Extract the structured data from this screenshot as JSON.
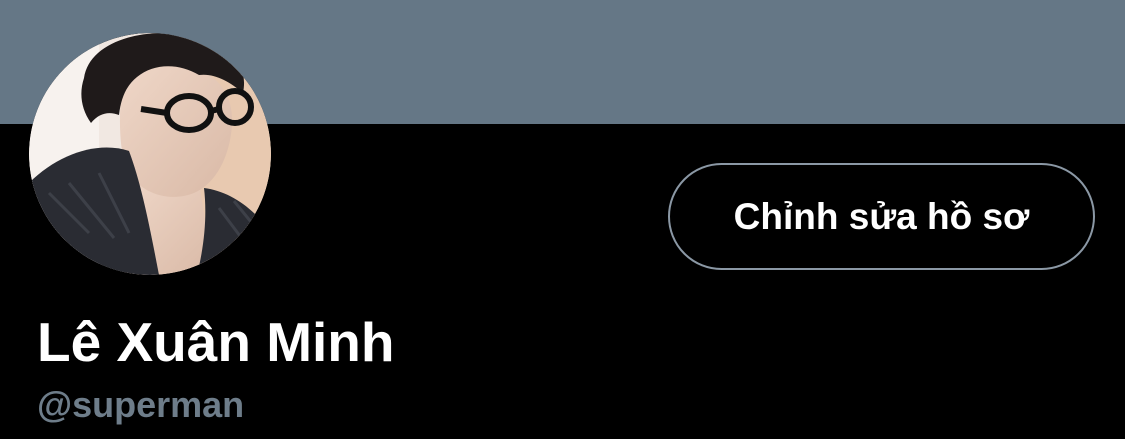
{
  "profile": {
    "display_name": "Lê Xuân Minh",
    "handle": "@superman",
    "edit_button_label": "Chỉnh sửa hồ sơ"
  },
  "colors": {
    "banner": "#657786",
    "background": "#000000",
    "text_primary": "#ffffff",
    "text_secondary": "#6e7d8a",
    "button_border": "#8b98a5"
  },
  "icons": {
    "avatar": "profile-photo"
  }
}
